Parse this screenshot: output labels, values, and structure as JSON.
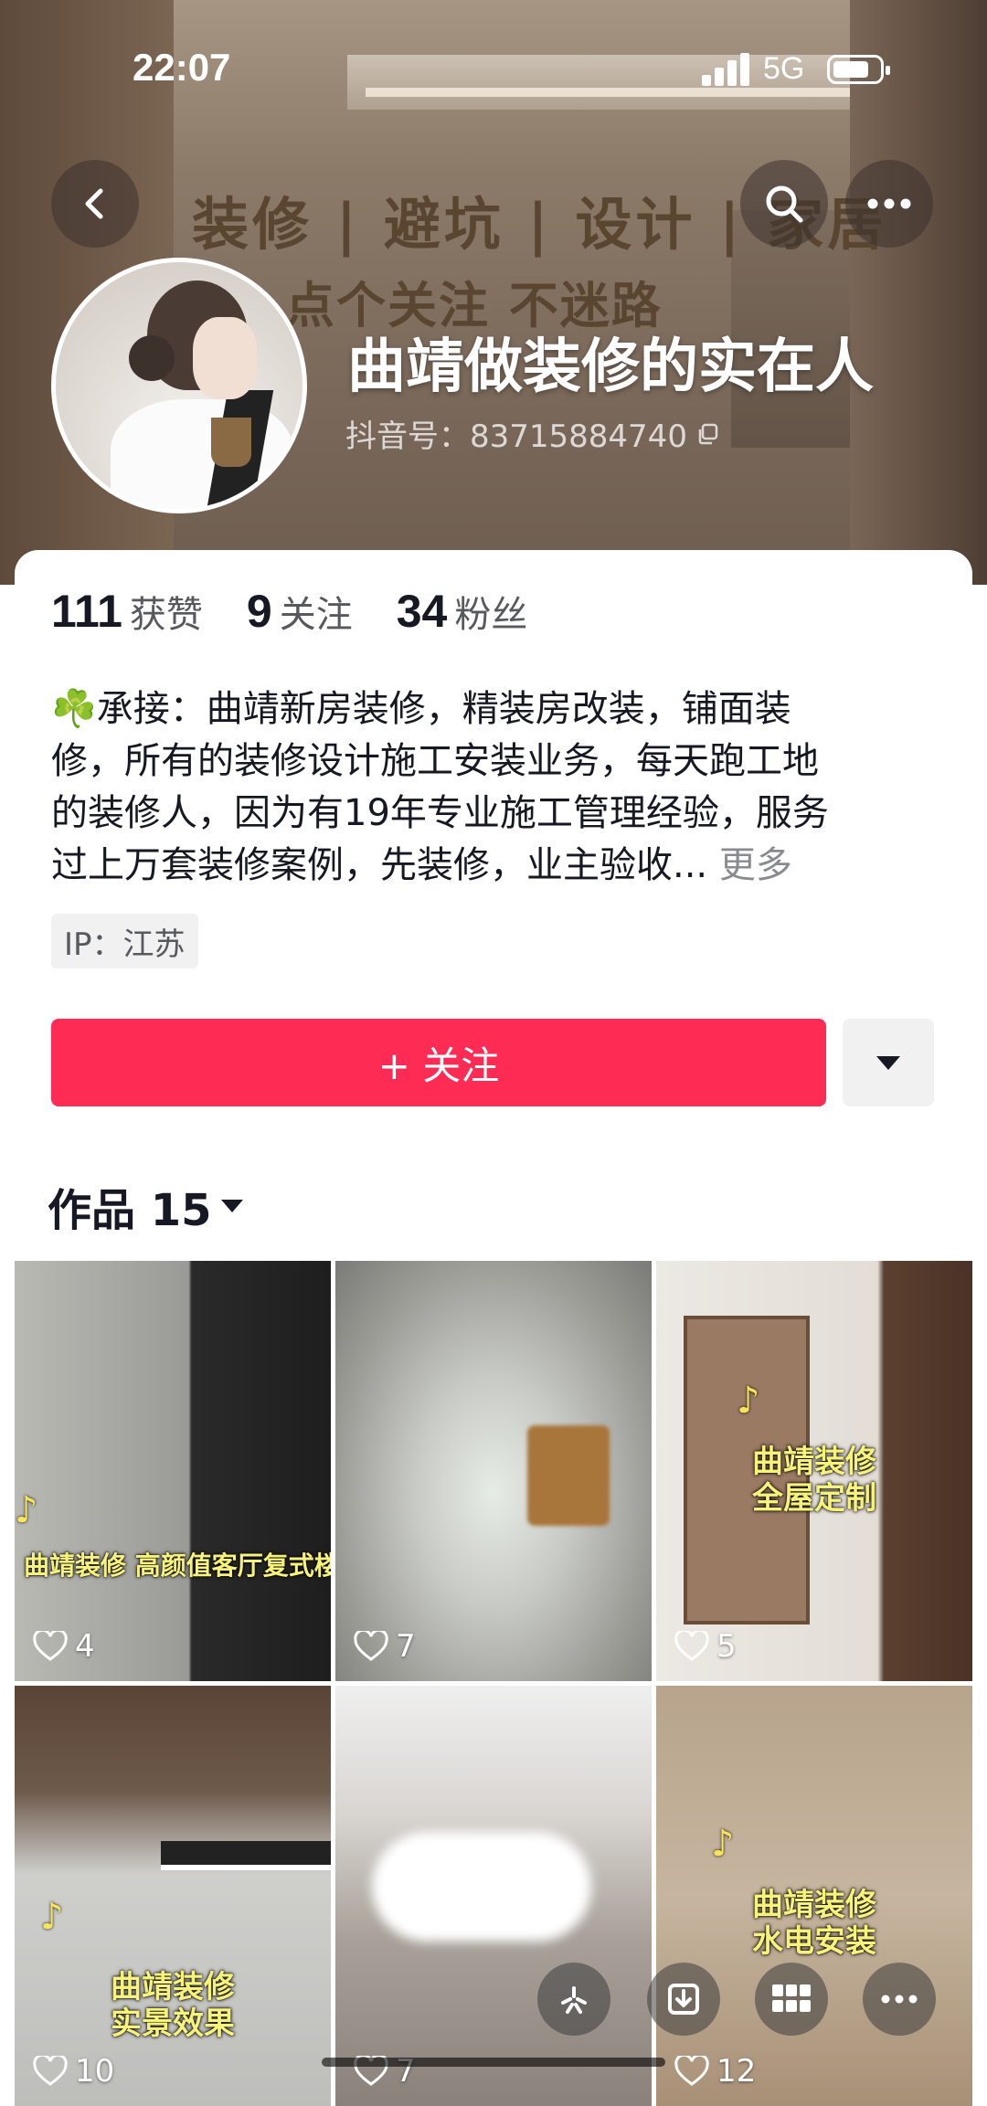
{
  "status_bar": {
    "time": "22:07",
    "network": "5G"
  },
  "banner": {
    "line1": "装修 | 避坑 | 设计 | 家居",
    "line2": "点个关注  不迷路"
  },
  "profile": {
    "nickname": "曲靖做装修的实在人",
    "douyin_id": "抖音号：83715884740",
    "stats": [
      {
        "num": "111",
        "label": "获赞"
      },
      {
        "num": "9",
        "label": "关注"
      },
      {
        "num": "34",
        "label": "粉丝"
      }
    ],
    "bio_lines": [
      "☘️承接：曲靖新房装修，精装房改装，铺面装",
      "修，所有的装修设计施工安装业务，每天跑工地",
      "的装修人，因为有19年专业施工管理经验，服务",
      "过上万套装修案例，先装修，业主验收..."
    ],
    "bio_more": "更多",
    "ip": "IP：江苏"
  },
  "actions": {
    "follow": "+ 关注"
  },
  "works": {
    "title": "作品 15",
    "items": [
      {
        "caption": "曲靖装修  高颜值客厅复式楼",
        "likes": "4"
      },
      {
        "caption": "",
        "likes": "7"
      },
      {
        "caption": "曲靖装修\n全屋定制",
        "likes": "5"
      },
      {
        "caption": "曲靖装修\n实景效果",
        "likes": "10"
      },
      {
        "caption": "",
        "likes": "7"
      },
      {
        "caption": "曲靖装修\n水电安装",
        "likes": "12"
      }
    ]
  },
  "icons": [
    "back-icon",
    "search-icon",
    "more-icon",
    "copy-icon",
    "caret-down-icon",
    "heart-icon",
    "sparkle-icon",
    "download-icon",
    "grid-icon"
  ]
}
